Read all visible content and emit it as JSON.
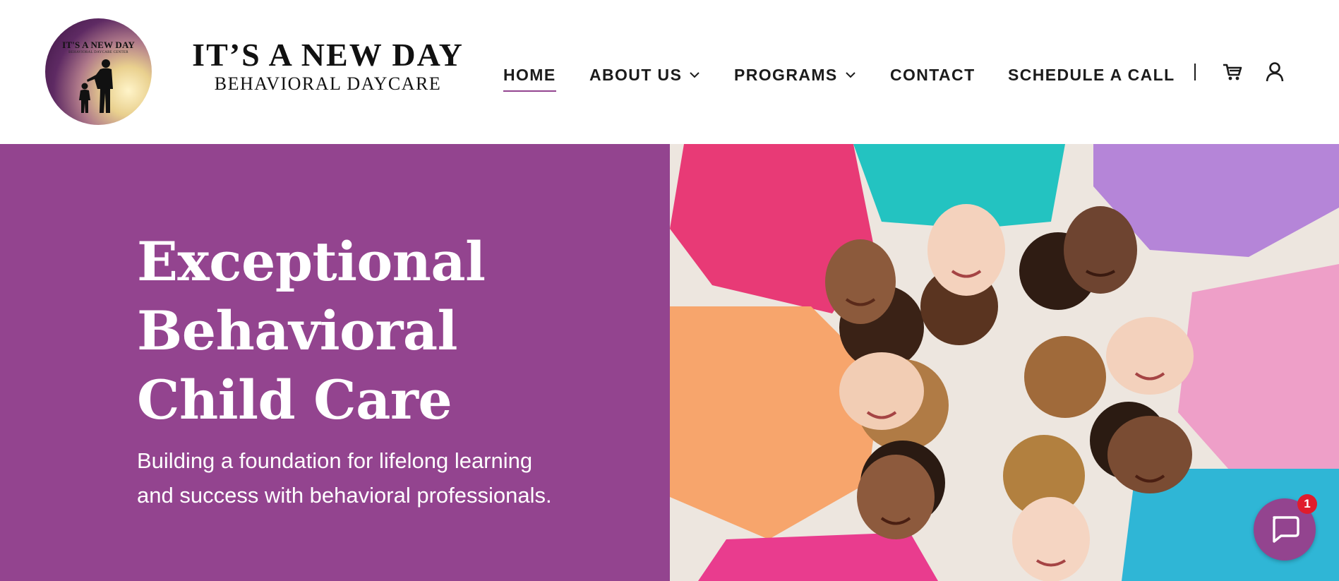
{
  "logo": {
    "badge_title": "IT'S A NEW DAY",
    "badge_subtitle": "BEHAVIORAL DAYCARE CENTER",
    "title": "IT’S A NEW DAY",
    "subtitle": "BEHAVIORAL DAYCARE"
  },
  "nav": {
    "items": [
      {
        "label": "HOME",
        "active": true
      },
      {
        "label": "ABOUT US",
        "dropdown": true
      },
      {
        "label": "PROGRAMS",
        "dropdown": true
      },
      {
        "label": "CONTACT"
      },
      {
        "label": "SCHEDULE A CALL"
      }
    ],
    "icons": [
      "cart-icon",
      "account-icon"
    ]
  },
  "hero": {
    "title_lines": [
      "Exceptional",
      "Behavioral",
      "Child Care"
    ],
    "subtitle": "Building a foundation for lifelong learning and success with behavioral professionals.",
    "image_icon": "children-photo"
  },
  "chat": {
    "badge_count": "1",
    "icon": "chat-bubble-icon"
  },
  "colors": {
    "brand": "#93448f",
    "text": "#1b1b1b",
    "badge": "#e01c2c"
  }
}
